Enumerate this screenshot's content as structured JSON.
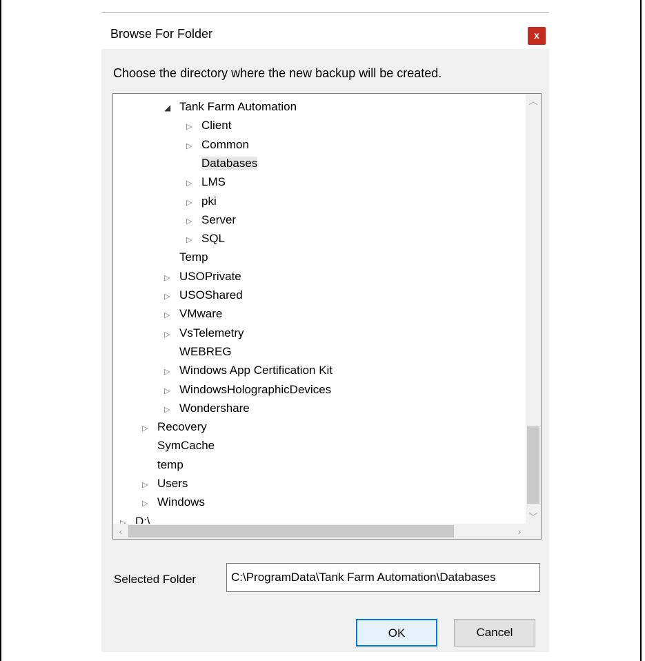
{
  "dialog": {
    "title": "Browse For Folder",
    "close_label": "x",
    "instructions": "Choose the directory where the new backup will be created."
  },
  "tree": [
    {
      "label": "Tank Farm Automation",
      "glyph": "◢",
      "state": "expanded",
      "level": 2
    },
    {
      "label": "Client",
      "glyph": "▷",
      "state": "collapsed",
      "level": 3
    },
    {
      "label": "Common",
      "glyph": "▷",
      "state": "collapsed",
      "level": 3
    },
    {
      "label": "Databases",
      "glyph": "",
      "state": "selected",
      "level": 3
    },
    {
      "label": "LMS",
      "glyph": "▷",
      "state": "collapsed",
      "level": 3
    },
    {
      "label": "pki",
      "glyph": "▷",
      "state": "collapsed",
      "level": 3
    },
    {
      "label": "Server",
      "glyph": "▷",
      "state": "collapsed",
      "level": 3
    },
    {
      "label": "SQL",
      "glyph": "▷",
      "state": "collapsed",
      "level": 3
    },
    {
      "label": "Temp",
      "glyph": "",
      "state": "leaf",
      "level": 2
    },
    {
      "label": "USOPrivate",
      "glyph": "▷",
      "state": "collapsed",
      "level": 2
    },
    {
      "label": "USOShared",
      "glyph": "▷",
      "state": "collapsed",
      "level": 2
    },
    {
      "label": "VMware",
      "glyph": "▷",
      "state": "collapsed",
      "level": 2
    },
    {
      "label": "VsTelemetry",
      "glyph": "▷",
      "state": "collapsed",
      "level": 2
    },
    {
      "label": "WEBREG",
      "glyph": "",
      "state": "leaf",
      "level": 2
    },
    {
      "label": "Windows App Certification Kit",
      "glyph": "▷",
      "state": "collapsed",
      "level": 2
    },
    {
      "label": "WindowsHolographicDevices",
      "glyph": "▷",
      "state": "collapsed",
      "level": 2
    },
    {
      "label": "Wondershare",
      "glyph": "▷",
      "state": "collapsed",
      "level": 2
    },
    {
      "label": "Recovery",
      "glyph": "▷",
      "state": "collapsed",
      "level": 1
    },
    {
      "label": "SymCache",
      "glyph": "",
      "state": "leaf",
      "level": 1
    },
    {
      "label": "temp",
      "glyph": "",
      "state": "leaf",
      "level": 1
    },
    {
      "label": "Users",
      "glyph": "▷",
      "state": "collapsed",
      "level": 1
    },
    {
      "label": "Windows",
      "glyph": "▷",
      "state": "collapsed",
      "level": 1
    },
    {
      "label": "D:\\",
      "glyph": "▷",
      "state": "collapsed",
      "level": 0
    }
  ],
  "scroll": {
    "up_arrow": "︿",
    "down_arrow": "﹀",
    "left_arrow": "‹",
    "right_arrow": "›"
  },
  "selected_folder": {
    "label": "Selected Folder",
    "value": "C:\\ProgramData\\Tank Farm Automation\\Databases"
  },
  "buttons": {
    "ok": "OK",
    "cancel": "Cancel"
  },
  "colors": {
    "close_button": "#c42b1c",
    "ok_border": "#0078d7",
    "dialog_bg": "#f0f0f0"
  }
}
